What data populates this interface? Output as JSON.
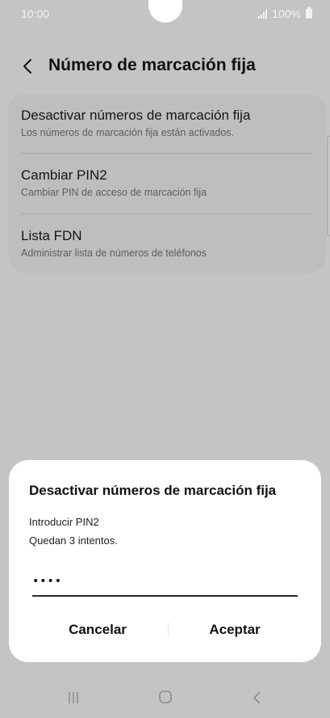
{
  "status_bar": {
    "time": "10:00",
    "battery": "100%"
  },
  "header": {
    "title": "Número de marcación fija"
  },
  "settings": {
    "items": [
      {
        "title": "Desactivar números de marcación fija",
        "subtitle": "Los números de marcación fija están activados."
      },
      {
        "title": "Cambiar PIN2",
        "subtitle": "Cambiar PIN de acceso de marcación fija"
      },
      {
        "title": "Lista FDN",
        "subtitle": "Administrar lista de números de teléfonos"
      }
    ]
  },
  "dialog": {
    "title": "Desactivar números de marcación fija",
    "message_line1": "Introducir PIN2",
    "message_line2": "Quedan 3 intentos.",
    "pin_value": "••••",
    "cancel_label": "Cancelar",
    "accept_label": "Aceptar"
  },
  "colors": {
    "dim_background": "#c4c4c4",
    "card": "#bebebe",
    "dialog": "#ffffff"
  },
  "nav_icons": [
    "recents-icon",
    "home-icon",
    "back-icon"
  ]
}
